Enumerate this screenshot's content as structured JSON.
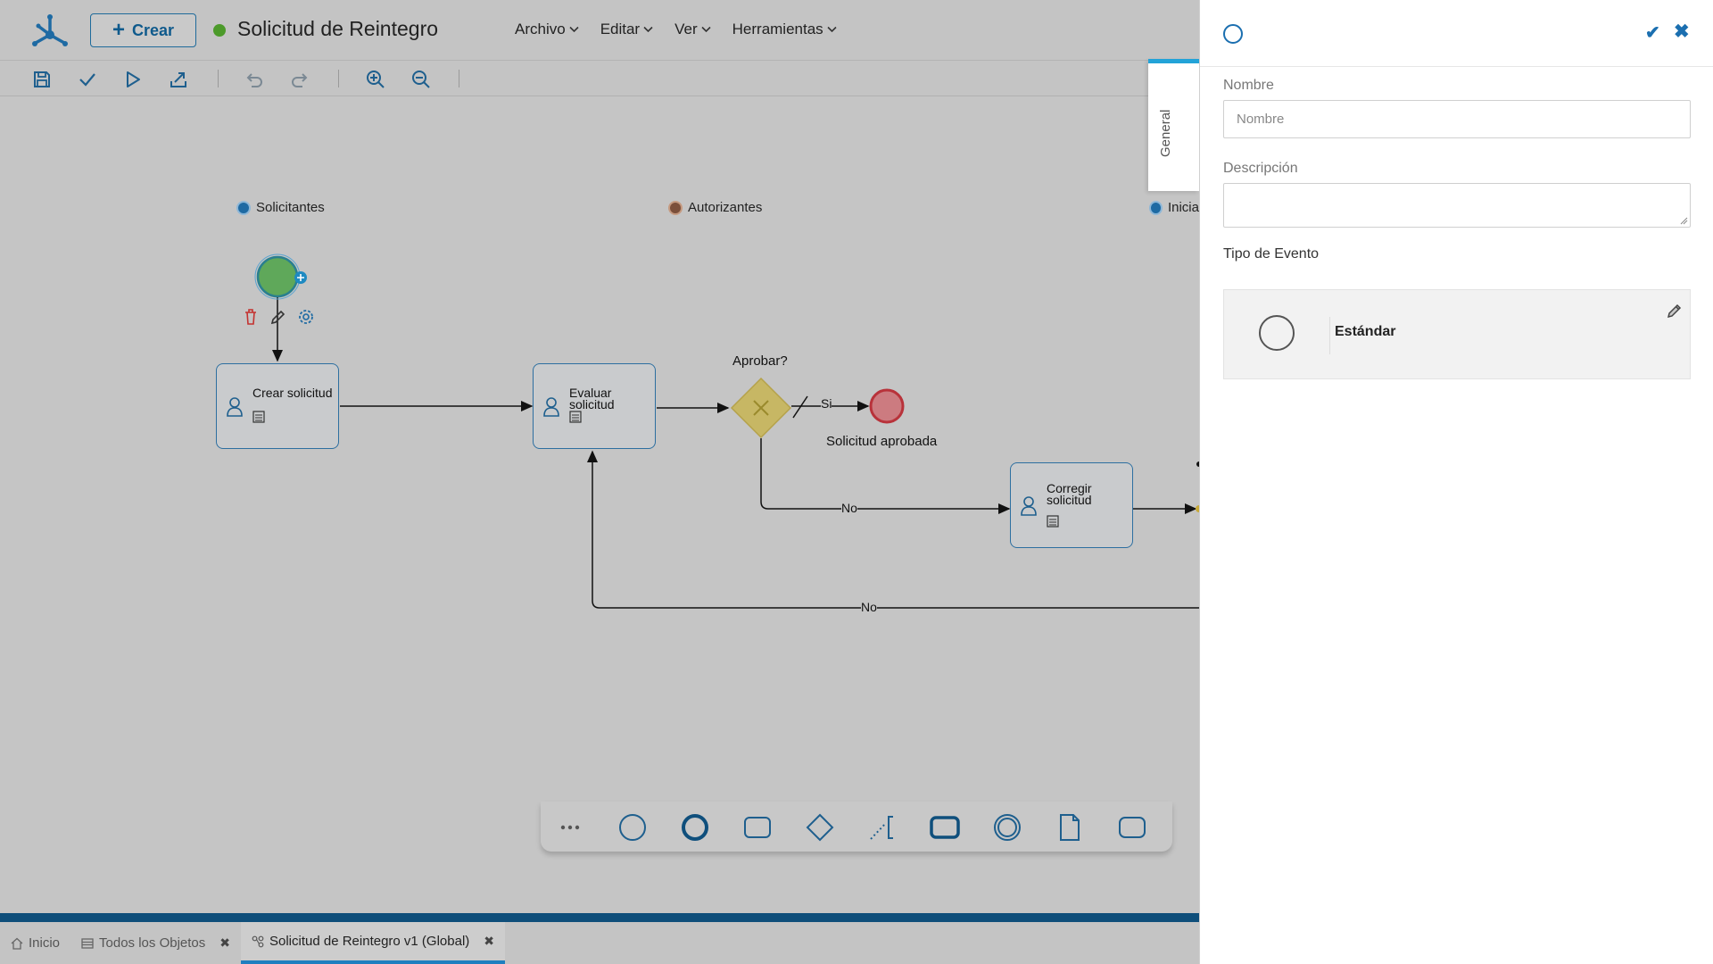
{
  "header": {
    "create_label": "Crear",
    "title": "Solicitud de Reintegro",
    "status_color": "#4c9a2a",
    "menu": [
      {
        "label": "Archivo"
      },
      {
        "label": "Editar"
      },
      {
        "label": "Ver"
      },
      {
        "label": "Herramientas"
      }
    ]
  },
  "toolbar": {
    "icons": [
      "save-icon",
      "check-icon",
      "play-icon",
      "export-icon",
      "undo-icon",
      "redo-icon",
      "zoom-in-icon",
      "zoom-out-icon"
    ]
  },
  "diagram": {
    "lanes": [
      {
        "label": "Solicitantes"
      },
      {
        "label": "Autorizantes"
      },
      {
        "label": "Inicia"
      }
    ],
    "tasks": [
      {
        "label": "Crear solicitud"
      },
      {
        "label": "Evaluar solicitud"
      },
      {
        "label": "Corregir solicitud"
      }
    ],
    "gateway_label": "Aprobar?",
    "end_event_label": "Solicitud aprobada",
    "flow_labels": {
      "yes": "Si",
      "no_1": "No",
      "no_2": "No"
    }
  },
  "palette": {
    "items": [
      "more-icon",
      "start-event-icon",
      "end-event-icon",
      "task-icon",
      "gateway-icon",
      "annotation-icon",
      "subprocess-icon",
      "intermediate-event-icon",
      "data-object-icon",
      "group-icon"
    ]
  },
  "tabs": [
    {
      "label": "Inicio",
      "closable": false
    },
    {
      "label": "Todos los Objetos",
      "closable": true
    },
    {
      "label": "Solicitud de Reintegro v1 (Global)",
      "closable": true,
      "active": true
    }
  ],
  "panel": {
    "side_tab": "General",
    "name_label": "Nombre",
    "name_placeholder": "Nombre",
    "name_value": "",
    "description_label": "Descripción",
    "description_value": "",
    "event_type_label": "Tipo de Evento",
    "event_type_value": "Estándar",
    "accent_color": "#1b6fb0"
  }
}
